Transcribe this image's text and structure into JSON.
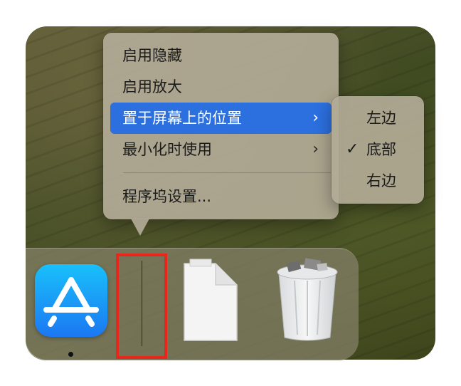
{
  "context_menu": {
    "items": [
      {
        "label": "启用隐藏",
        "submenu": false,
        "selected": false
      },
      {
        "label": "启用放大",
        "submenu": false,
        "selected": false
      },
      {
        "label": "置于屏幕上的位置",
        "submenu": true,
        "selected": true
      },
      {
        "label": "最小化时使用",
        "submenu": true,
        "selected": false
      },
      {
        "label": "程序坞设置...",
        "submenu": false,
        "selected": false
      }
    ],
    "chevron": "›"
  },
  "position_submenu": {
    "items": [
      {
        "label": "左边",
        "checked": false
      },
      {
        "label": "底部",
        "checked": true
      },
      {
        "label": "右边",
        "checked": false
      }
    ],
    "check_glyph": "✓"
  },
  "dock": {
    "apps": [
      {
        "icon": "app-store-icon",
        "running": true
      },
      {
        "icon": "dock-divider",
        "highlighted": true
      },
      {
        "icon": "document-icon"
      },
      {
        "icon": "trash-full-icon"
      }
    ]
  },
  "colors": {
    "selection": "#2c6fde",
    "highlight_box": "#e8261c",
    "menu_bg": "#b2aa96"
  }
}
